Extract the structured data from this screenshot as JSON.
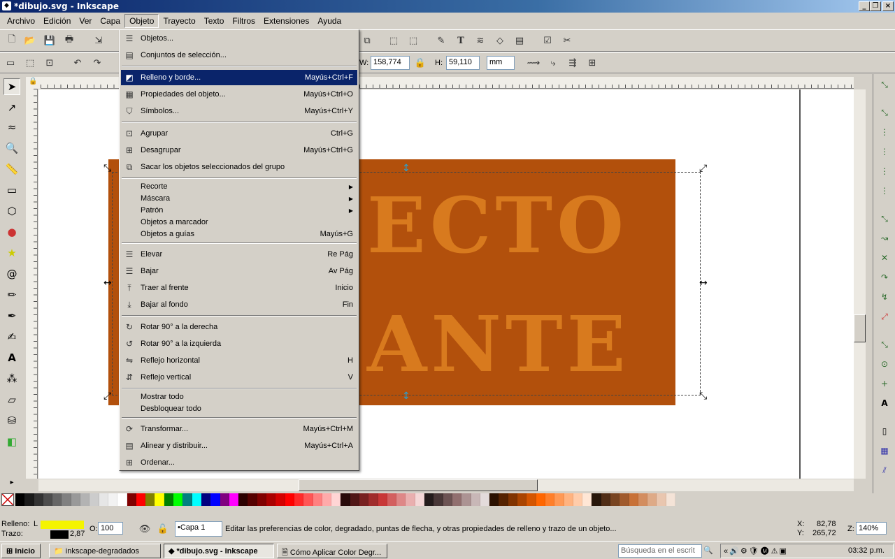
{
  "window": {
    "title": "*dibujo.svg - Inkscape"
  },
  "menubar": [
    "Archivo",
    "Edición",
    "Ver",
    "Capa",
    "Objeto",
    "Trayecto",
    "Texto",
    "Filtros",
    "Extensiones",
    "Ayuda"
  ],
  "ctrlbar": {
    "w_label": "W:",
    "w_value": "158,774",
    "h_label": "H:",
    "h_value": "59,110",
    "unit": "mm"
  },
  "canvas": {
    "line1": "ECTO",
    "line2": "ANTE",
    "rect_color": "#b2500c",
    "text_color": "#d87a1e"
  },
  "menu": {
    "items": [
      {
        "icon": "objects-icon",
        "label": "Objetos...",
        "shortcut": ""
      },
      {
        "icon": "selection-sets-icon",
        "label": "Conjuntos de selección...",
        "shortcut": ""
      },
      {
        "icon": "fill-stroke-icon",
        "label": "Relleno y borde...",
        "shortcut": "Mayús+Ctrl+F",
        "highlighted": true
      },
      {
        "icon": "object-properties-icon",
        "label": "Propiedades del objeto...",
        "shortcut": "Mayús+Ctrl+O"
      },
      {
        "icon": "symbols-icon",
        "label": "Símbolos...",
        "shortcut": "Mayús+Ctrl+Y"
      },
      {
        "icon": "group-icon",
        "label": "Agrupar",
        "shortcut": "Ctrl+G"
      },
      {
        "icon": "ungroup-icon",
        "label": "Desagrupar",
        "shortcut": "Mayús+Ctrl+G"
      },
      {
        "icon": "pop-from-group-icon",
        "label": "Sacar los objetos seleccionados del grupo",
        "shortcut": ""
      },
      {
        "icon": "",
        "label": "Recorte",
        "shortcut": "",
        "submenu": true
      },
      {
        "icon": "",
        "label": "Máscara",
        "shortcut": "",
        "submenu": true
      },
      {
        "icon": "",
        "label": "Patrón",
        "shortcut": "",
        "submenu": true
      },
      {
        "icon": "",
        "label": "Objetos a marcador",
        "shortcut": ""
      },
      {
        "icon": "",
        "label": "Objetos a guías",
        "shortcut": "Mayús+G"
      },
      {
        "icon": "raise-icon",
        "label": "Elevar",
        "shortcut": "Re Pág"
      },
      {
        "icon": "lower-icon",
        "label": "Bajar",
        "shortcut": "Av Pág"
      },
      {
        "icon": "raise-to-top-icon",
        "label": "Traer al frente",
        "shortcut": "Inicio"
      },
      {
        "icon": "lower-to-bottom-icon",
        "label": "Bajar al fondo",
        "shortcut": "Fin"
      },
      {
        "icon": "rotate-cw-icon",
        "label": "Rotar 90° a la derecha",
        "shortcut": ""
      },
      {
        "icon": "rotate-ccw-icon",
        "label": "Rotar 90° a la izquierda",
        "shortcut": ""
      },
      {
        "icon": "flip-horizontal-icon",
        "label": "Reflejo horizontal",
        "shortcut": "H"
      },
      {
        "icon": "flip-vertical-icon",
        "label": "Reflejo vertical",
        "shortcut": "V"
      },
      {
        "icon": "",
        "label": "Mostrar todo",
        "shortcut": ""
      },
      {
        "icon": "",
        "label": "Desbloquear todo",
        "shortcut": ""
      },
      {
        "icon": "transform-icon",
        "label": "Transformar...",
        "shortcut": "Mayús+Ctrl+M"
      },
      {
        "icon": "align-distribute-icon",
        "label": "Alinear y distribuir...",
        "shortcut": "Mayús+Ctrl+A"
      },
      {
        "icon": "arrange-icon",
        "label": "Ordenar...",
        "shortcut": ""
      }
    ]
  },
  "status": {
    "fill_label": "Relleno:",
    "fill_type": "L",
    "stroke_label": "Trazo:",
    "stroke_width": "2,87",
    "opacity_label": "O:",
    "opacity_value": "100",
    "layer": "•Capa 1",
    "message": "Editar las preferencias de color, degradado, puntas de flecha, y otras propiedades de relleno y trazo de un objeto...",
    "x_label": "X:",
    "x_value": "82,78",
    "y_label": "Y:",
    "y_value": "265,72",
    "zoom_label": "Z:",
    "zoom_value": "140%",
    "fill_color": "#f4f400"
  },
  "taskbar": {
    "start": "Inicio",
    "buttons": [
      "inkscape-degradados",
      "*dibujo.svg - Inkscape",
      "Cómo Aplicar Color Degr..."
    ],
    "search_placeholder": "Búsqueda en el escrit",
    "clock": "03:32 p.m."
  },
  "palette": [
    "#000000",
    "#1a1a1a",
    "#333333",
    "#4d4d4d",
    "#666666",
    "#808080",
    "#999999",
    "#b3b3b3",
    "#cccccc",
    "#e6e6e6",
    "#f2f2f2",
    "#ffffff",
    "#800000",
    "#ff0000",
    "#808000",
    "#ffff00",
    "#008000",
    "#00ff00",
    "#008080",
    "#00ffff",
    "#000080",
    "#0000ff",
    "#800080",
    "#ff00ff",
    "#2b0000",
    "#550000",
    "#800000",
    "#aa0000",
    "#d40000",
    "#ff0000",
    "#ff2a2a",
    "#ff5555",
    "#ff8080",
    "#ffaaaa",
    "#ffd5d5",
    "#280b0b",
    "#501616",
    "#782121",
    "#a02c2c",
    "#c83737",
    "#d35f5f",
    "#de8787",
    "#e9afaf",
    "#f4d7d7",
    "#241c1c",
    "#483737",
    "#6c5353",
    "#916f6f",
    "#ac9393",
    "#c8b7b7",
    "#e3dbdb",
    "#2b1100",
    "#552200",
    "#803300",
    "#aa4400",
    "#d45500",
    "#ff6600",
    "#ff7f2a",
    "#ff9955",
    "#ffb380",
    "#ffccaa",
    "#ffe6d5",
    "#28170b",
    "#502d16",
    "#784421",
    "#a05a2c",
    "#c87137",
    "#d38d5f",
    "#deaa87",
    "#e9c6af",
    "#f4e3d7"
  ]
}
